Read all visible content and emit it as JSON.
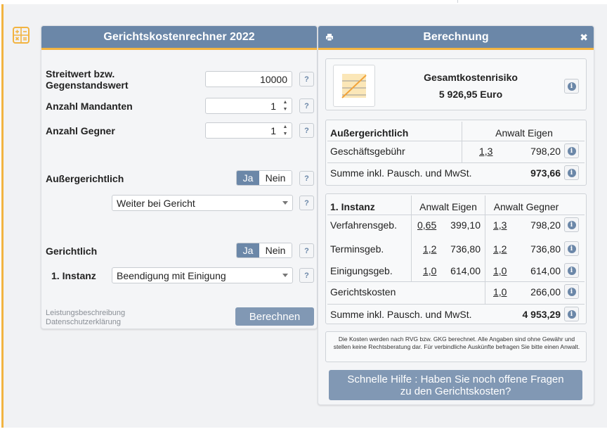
{
  "left_panel": {
    "title": "Gerichtskostenrechner 2022",
    "streitwert": {
      "label": "Streitwert bzw. Gegenstandswert",
      "value": "10000"
    },
    "mandanten": {
      "label": "Anzahl Mandanten",
      "value": "1"
    },
    "gegner": {
      "label": "Anzahl Gegner",
      "value": "1"
    },
    "aussergerichtlich": {
      "label": "Außergerichtlich",
      "yes": "Ja",
      "no": "Nein",
      "select_value": "Weiter bei Gericht"
    },
    "gerichtlich": {
      "label": "Gerichtlich",
      "yes": "Ja",
      "no": "Nein"
    },
    "instanz": {
      "label": "1. Instanz",
      "select_value": "Beendigung mit Einigung"
    },
    "help_label": "?",
    "links": {
      "leistung": "Leistungsbeschreibung",
      "datenschutz": "Datenschutzerklärung"
    },
    "button_label": "Berechnen"
  },
  "right_panel": {
    "title": "Berechnung",
    "close_label": "✖",
    "summary": {
      "title": "Gesamtkostenrisiko",
      "amount": "5 926,95 Euro"
    },
    "aussergerichtlich": {
      "heading": "Außergerichtlich",
      "col": "Anwalt Eigen",
      "row_label": "Geschäftsgebühr",
      "rate": "1,3",
      "amount": "798,20",
      "sum_label": "Summe inkl. Pausch. und MwSt.",
      "sum_value": "973,66"
    },
    "instanz": {
      "heading": "1. Instanz",
      "col_eigen": "Anwalt Eigen",
      "col_gegner": "Anwalt Gegner",
      "rows": [
        {
          "label": "Verfahrensgeb.",
          "rate_e": "0,65",
          "amt_e": "399,10",
          "rate_g": "1,3",
          "amt_g": "798,20"
        },
        {
          "label": "Terminsgeb.",
          "rate_e": "1,2",
          "amt_e": "736,80",
          "rate_g": "1,2",
          "amt_g": "736,80"
        },
        {
          "label": "Einigungsgeb.",
          "rate_e": "1,0",
          "amt_e": "614,00",
          "rate_g": "1,0",
          "amt_g": "614,00"
        }
      ],
      "gerichtskosten": {
        "label": "Gerichtskosten",
        "rate": "1,0",
        "amount": "266,00"
      },
      "sum_label": "Summe inkl. Pausch. und MwSt.",
      "sum_value": "4 953,29"
    },
    "info_label": "i",
    "disclaimer": "Die Kosten werden nach RVG bzw. GKG berechnet. Alle Angaben sind ohne Gewähr und stellen keine Rechtsberatung dar. Für verbindliche Auskünfte befragen Sie bitte einen Anwalt.",
    "help_button": "Schnelle Hilfe : Haben Sie noch offene Fragen zu den Gerichtskosten?"
  },
  "colors": {
    "accent": "#f2b441",
    "primary": "#6b87a8",
    "button": "#8198b4"
  }
}
